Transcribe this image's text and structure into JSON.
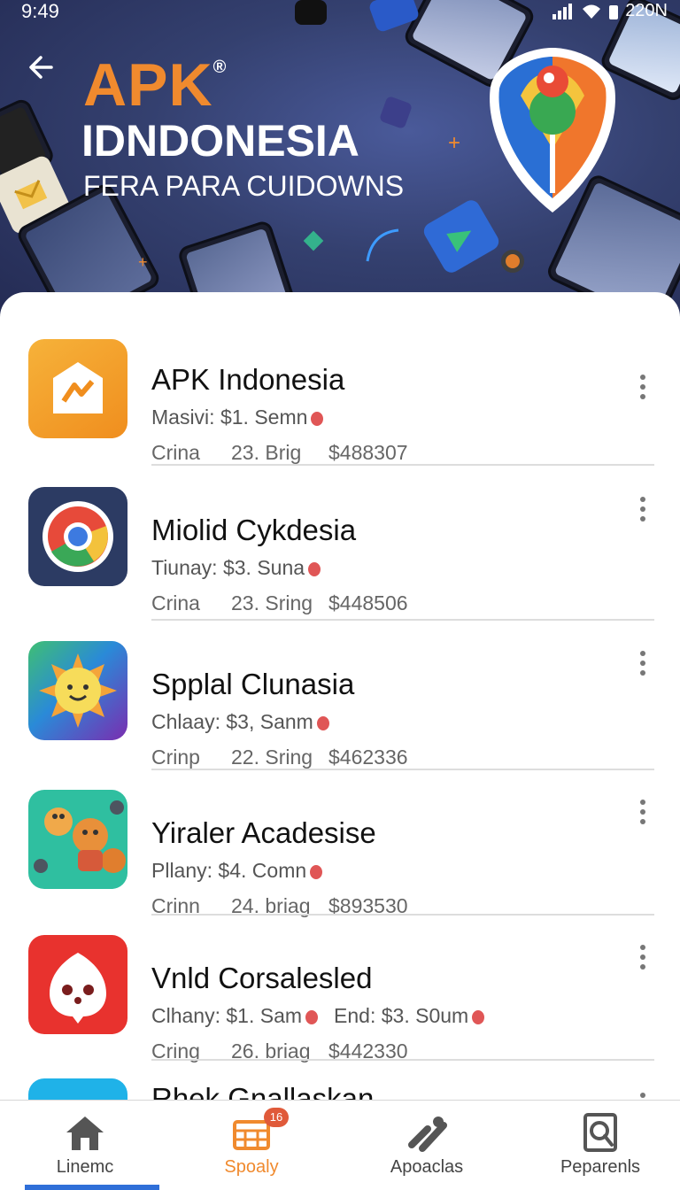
{
  "status_bar": {
    "time": "9:49",
    "right_text": "220N"
  },
  "hero": {
    "brand": "APK",
    "brand_mark": "®",
    "title": "IDNDONESIA",
    "subtitle": "FERA PARA CUIDOWNS",
    "colors": {
      "brand": "#f08a2e",
      "background": "#34406f"
    }
  },
  "apps": [
    {
      "name": "APK Indonesia",
      "meta": "Masivi: $1. Semn",
      "meta2": "",
      "stat1": "Crina",
      "stat2": "23. Brig",
      "stat3": "$488307",
      "icon": "mail-icon"
    },
    {
      "name": "Miolid Cykdesia",
      "meta": "Tiunay: $3. Suna",
      "meta2": "",
      "stat1": "Crina",
      "stat2": "23. Sring",
      "stat3": "$448506",
      "icon": "chrome-icon"
    },
    {
      "name": "Spplal Clunasia",
      "meta": "Chlaay: $3, Sanm",
      "meta2": "",
      "stat1": "Crinp",
      "stat2": "22. Sring",
      "stat3": "$462336",
      "icon": "sun-icon"
    },
    {
      "name": "Yiraler Acadesise",
      "meta": "Pllany: $4. Comn",
      "meta2": "",
      "stat1": "Crinn",
      "stat2": "24. briag",
      "stat3": "$893530",
      "icon": "game-characters-icon"
    },
    {
      "name": "Vnld Corsalesled",
      "meta": "Clhany: $1. Sam",
      "meta2": "End: $3. S0um",
      "stat1": "Cring",
      "stat2": "26. briag",
      "stat3": "$442330",
      "icon": "ghost-icon"
    },
    {
      "name": "Rhek Gnallaskan",
      "meta": "",
      "meta2": "",
      "stat1": "",
      "stat2": "",
      "stat3": "",
      "icon": "blue-app-icon"
    }
  ],
  "bottom_nav": [
    {
      "label": "Linemc",
      "icon": "home-icon",
      "active": false
    },
    {
      "label": "Spoaly",
      "icon": "store-icon",
      "active": true,
      "badge": "16"
    },
    {
      "label": "Apoaclas",
      "icon": "tools-icon",
      "active": false
    },
    {
      "label": "Peparenls",
      "icon": "search-doc-icon",
      "active": false
    }
  ]
}
